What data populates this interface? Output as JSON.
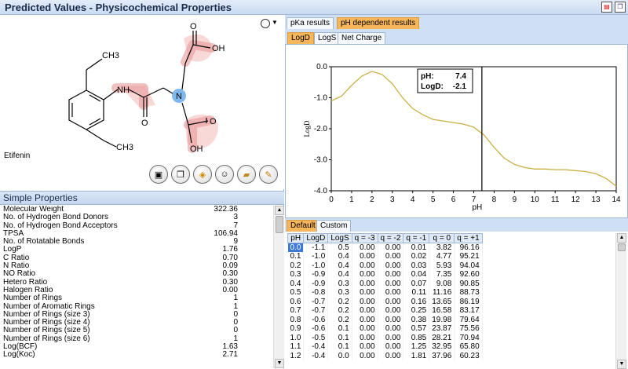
{
  "window": {
    "title": "Predicted Values - Physicochemical Properties",
    "pdf_icon": "PDF",
    "copy_icon": "copy"
  },
  "structure": {
    "compound_name": "Etifenin",
    "atom_labels": {
      "ch3_top": "CH3",
      "ch3_bottom": "CH3",
      "nh": "NH",
      "n": "N",
      "oh_top": "OH",
      "oh_bottom": "OH",
      "o_left": "O",
      "o_top": "O",
      "o_bottom": "O"
    },
    "toolbar": [
      {
        "name": "view-2d-button",
        "icon": "▣"
      },
      {
        "name": "view-3d-button",
        "icon": "▤"
      },
      {
        "name": "export-button",
        "icon": "✎"
      },
      {
        "name": "smile-button",
        "icon": "☺"
      },
      {
        "name": "open-button",
        "icon": "📂"
      },
      {
        "name": "edit-button",
        "icon": "✏"
      }
    ]
  },
  "simple_properties": {
    "header": "Simple Properties",
    "rows": [
      {
        "label": "Molecular Weight",
        "value": "322.36"
      },
      {
        "label": "No. of Hydrogen Bond Donors",
        "value": "3"
      },
      {
        "label": "No. of Hydrogen Bond Acceptors",
        "value": "7"
      },
      {
        "label": "TPSA",
        "value": "106.94"
      },
      {
        "label": "No. of Rotatable Bonds",
        "value": "9"
      },
      {
        "label": "LogP",
        "value": "1.76"
      },
      {
        "label": "C Ratio",
        "value": "0.70"
      },
      {
        "label": "N Ratio",
        "value": "0.09"
      },
      {
        "label": "NO Ratio",
        "value": "0.30"
      },
      {
        "label": "Hetero Ratio",
        "value": "0.30"
      },
      {
        "label": "Halogen Ratio",
        "value": "0.00"
      },
      {
        "label": "Number of Rings",
        "value": "1"
      },
      {
        "label": "Number of Aromatic Rings",
        "value": "1"
      },
      {
        "label": "Number of Rings (size 3)",
        "value": "0"
      },
      {
        "label": "Number of Rings (size 4)",
        "value": "0"
      },
      {
        "label": "Number of Rings (size 5)",
        "value": "0"
      },
      {
        "label": "Number of Rings (size 6)",
        "value": "1"
      },
      {
        "label": "Log(BCF)",
        "value": "1.63"
      },
      {
        "label": "Log(Koc)",
        "value": "2.71"
      }
    ]
  },
  "results_tabs": {
    "pka": "pKa results",
    "ph": "pH dependent results"
  },
  "chart_tabs": {
    "logd": "LogD",
    "logs": "LogS",
    "net_charge": "Net Charge"
  },
  "chart_data": {
    "type": "line",
    "xlabel": "pH",
    "ylabel": "LogD",
    "xlim": [
      0,
      14
    ],
    "ylim": [
      -4.0,
      0.0
    ],
    "xticks": [
      0,
      1,
      2,
      3,
      4,
      5,
      6,
      7,
      8,
      9,
      10,
      11,
      12,
      13,
      14
    ],
    "yticks": [
      "0.0",
      "-1.0",
      "-2.0",
      "-3.0",
      "-4.0"
    ],
    "cursor_ph": 7.4,
    "tooltip": {
      "ph_label": "pH:",
      "ph_value": "7.4",
      "logd_label": "LogD:",
      "logd_value": "-2.1"
    },
    "series": [
      {
        "x": [
          0,
          0.5,
          1,
          1.5,
          2,
          2.5,
          3,
          3.5,
          4,
          4.5,
          5,
          5.5,
          6,
          6.5,
          7,
          7.5,
          8,
          8.5,
          9,
          9.5,
          10,
          10.5,
          11,
          11.5,
          12,
          12.5,
          13,
          13.5,
          14
        ],
        "y": [
          -1.1,
          -0.95,
          -0.6,
          -0.3,
          -0.15,
          -0.25,
          -0.55,
          -1.0,
          -1.35,
          -1.55,
          -1.7,
          -1.75,
          -1.8,
          -1.85,
          -1.95,
          -2.2,
          -2.6,
          -2.95,
          -3.15,
          -3.25,
          -3.3,
          -3.3,
          -3.32,
          -3.32,
          -3.35,
          -3.38,
          -3.45,
          -3.6,
          -3.85
        ],
        "color": "#c9b046"
      }
    ]
  },
  "table_tabs": {
    "default": "Default",
    "custom": "Custom"
  },
  "ph_table": {
    "columns": [
      "pH",
      "LogD",
      "LogS",
      "q = -3",
      "q = -2",
      "q = -1",
      "q = 0",
      "q = +1"
    ],
    "rows": [
      [
        "0.0",
        "-1.1",
        "0.5",
        "0.00",
        "0.00",
        "0.01",
        "3.82",
        "96.16"
      ],
      [
        "0.1",
        "-1.0",
        "0.4",
        "0.00",
        "0.00",
        "0.02",
        "4.77",
        "95.21"
      ],
      [
        "0.2",
        "-1.0",
        "0.4",
        "0.00",
        "0.00",
        "0.03",
        "5.93",
        "94.04"
      ],
      [
        "0.3",
        "-0.9",
        "0.4",
        "0.00",
        "0.00",
        "0.04",
        "7.35",
        "92.60"
      ],
      [
        "0.4",
        "-0.9",
        "0.3",
        "0.00",
        "0.00",
        "0.07",
        "9.08",
        "90.85"
      ],
      [
        "0.5",
        "-0.8",
        "0.3",
        "0.00",
        "0.00",
        "0.11",
        "11.16",
        "88.73"
      ],
      [
        "0.6",
        "-0.7",
        "0.2",
        "0.00",
        "0.00",
        "0.16",
        "13.65",
        "86.19"
      ],
      [
        "0.7",
        "-0.7",
        "0.2",
        "0.00",
        "0.00",
        "0.25",
        "16.58",
        "83.17"
      ],
      [
        "0.8",
        "-0.6",
        "0.2",
        "0.00",
        "0.00",
        "0.38",
        "19.98",
        "79.64"
      ],
      [
        "0.9",
        "-0.6",
        "0.1",
        "0.00",
        "0.00",
        "0.57",
        "23.87",
        "75.56"
      ],
      [
        "1.0",
        "-0.5",
        "0.1",
        "0.00",
        "0.00",
        "0.85",
        "28.21",
        "70.94"
      ],
      [
        "1.1",
        "-0.4",
        "0.1",
        "0.00",
        "0.00",
        "1.25",
        "32.95",
        "65.80"
      ],
      [
        "1.2",
        "-0.4",
        "0.0",
        "0.00",
        "0.00",
        "1.81",
        "37.96",
        "60.23"
      ]
    ]
  }
}
